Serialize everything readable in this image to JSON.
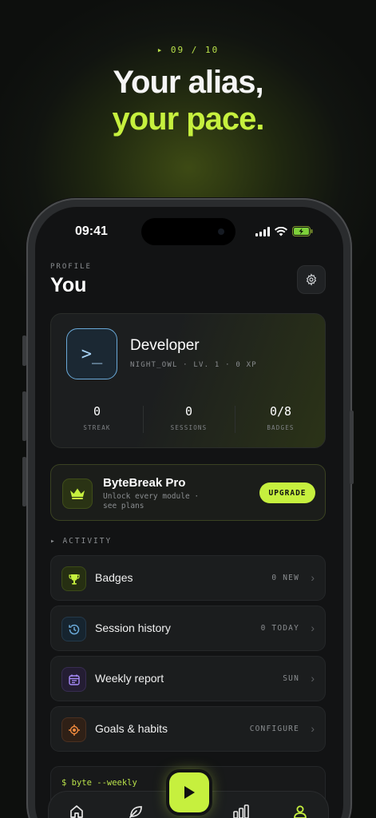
{
  "hero": {
    "eyebrow": "▸ 09 / 10",
    "line1": "Your alias,",
    "line2": "your pace."
  },
  "status_bar": {
    "time": "09:41",
    "icons": [
      "signal-icon",
      "wifi-icon",
      "battery-charging-icon"
    ]
  },
  "header": {
    "label": "PROFILE",
    "title": "You",
    "settings_icon": "gear-icon"
  },
  "profile": {
    "avatar_glyph": ">_",
    "name": "Developer",
    "subtitle": "NIGHT_OWL · LV. 1 · 0 XP",
    "stats": [
      {
        "value": "0",
        "label": "STREAK"
      },
      {
        "value": "0",
        "label": "SESSIONS"
      },
      {
        "value": "0/8",
        "label": "BADGES"
      }
    ]
  },
  "pro": {
    "icon": "crown-icon",
    "title": "ByteBreak Pro",
    "subtitle": "Unlock every module · see plans",
    "button": "UPGRADE"
  },
  "activity": {
    "label": "▸ ACTIVITY",
    "rows": [
      {
        "icon": "trophy-icon",
        "label": "Badges",
        "meta": "0 NEW",
        "accent": "#c6f03e"
      },
      {
        "icon": "history-icon",
        "label": "Session history",
        "meta": "0 TODAY",
        "accent": "#6aa9d8"
      },
      {
        "icon": "calendar-icon",
        "label": "Weekly report",
        "meta": "SUN",
        "accent": "#a78bfa"
      },
      {
        "icon": "target-icon",
        "label": "Goals & habits",
        "meta": "CONFIGURE",
        "accent": "#f08a3e"
      }
    ]
  },
  "terminal": {
    "command": "$ byte --weekly"
  },
  "tabbar": {
    "items": [
      "home-icon",
      "leaf-icon",
      "play-icon",
      "stats-icon",
      "profile-icon"
    ],
    "active": "profile-icon"
  },
  "colors": {
    "accent": "#c6f03e",
    "background": "#121314"
  }
}
